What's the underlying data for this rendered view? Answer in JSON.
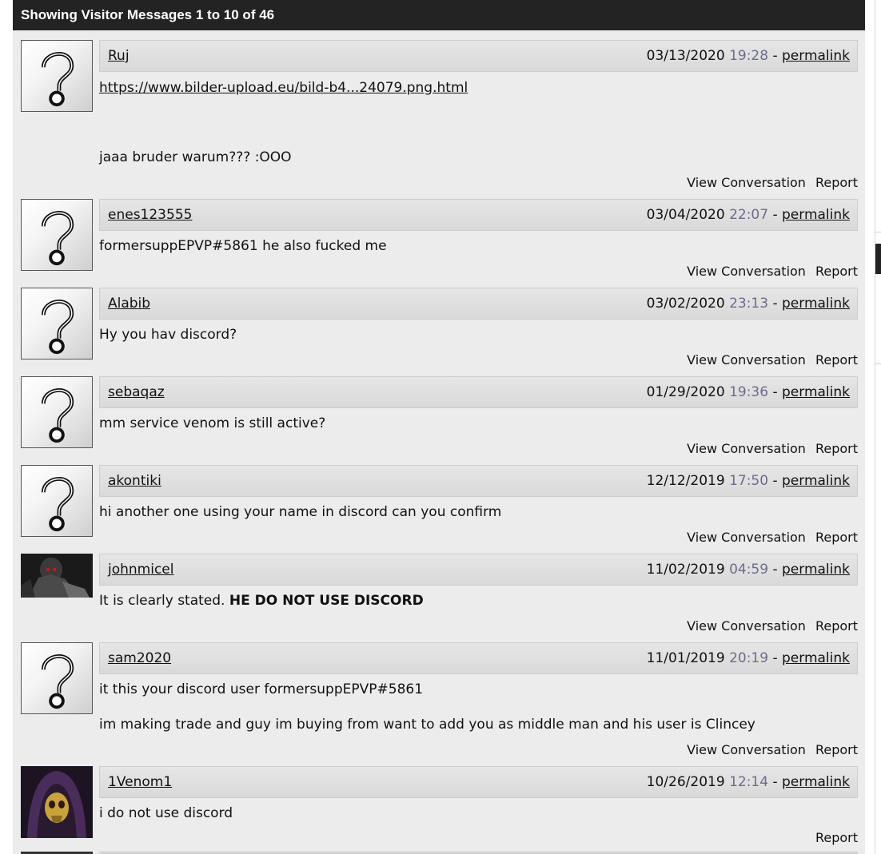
{
  "header": {
    "title": "Showing Visitor Messages 1 to 10 of 46"
  },
  "actions": {
    "view": "View Conversation",
    "report": "Report"
  },
  "messages": [
    {
      "user": "Ruj",
      "date": "03/13/2020",
      "time": "19:28",
      "permalink": "permalink",
      "avatar": "default-avatar",
      "link": "https://www.bilder-upload.eu/bild-b4...24079.png.html",
      "line1": "jaaa bruder warum??? :OOO"
    },
    {
      "user": "enes123555",
      "date": "03/04/2020",
      "time": "22:07",
      "permalink": "permalink",
      "avatar": "default-avatar",
      "line1": "formersuppEPVP#5861 he also fucked me"
    },
    {
      "user": "Alabib",
      "date": "03/02/2020",
      "time": "23:13",
      "permalink": "permalink",
      "avatar": "default-avatar",
      "line1": "Hy you hav discord?"
    },
    {
      "user": "sebaqaz",
      "date": "01/29/2020",
      "time": "19:36",
      "permalink": "permalink",
      "avatar": "default-avatar",
      "line1": "mm service venom is still active?"
    },
    {
      "user": "akontiki",
      "date": "12/12/2019",
      "time": "17:50",
      "permalink": "permalink",
      "avatar": "default-avatar",
      "line1": "hi another one using your name in discord can you confirm"
    },
    {
      "user": "johnmicel",
      "date": "11/02/2019",
      "time": "04:59",
      "permalink": "permalink",
      "avatar": "reaper-photo",
      "line1": "It is clearly stated.",
      "bold": "HE DO NOT USE DISCORD"
    },
    {
      "user": "sam2020",
      "date": "11/01/2019",
      "time": "20:19",
      "permalink": "permalink",
      "avatar": "default-avatar",
      "line1": "it this your discord user formersuppEPVP#5861",
      "line2": "im making trade and guy im buying from want to add you as middle man and his user is Clincey"
    },
    {
      "user": "1Venom1",
      "date": "10/26/2019",
      "time": "12:14",
      "permalink": "permalink",
      "avatar": "skull-hood-photo",
      "line1": "i do not use discord"
    }
  ]
}
